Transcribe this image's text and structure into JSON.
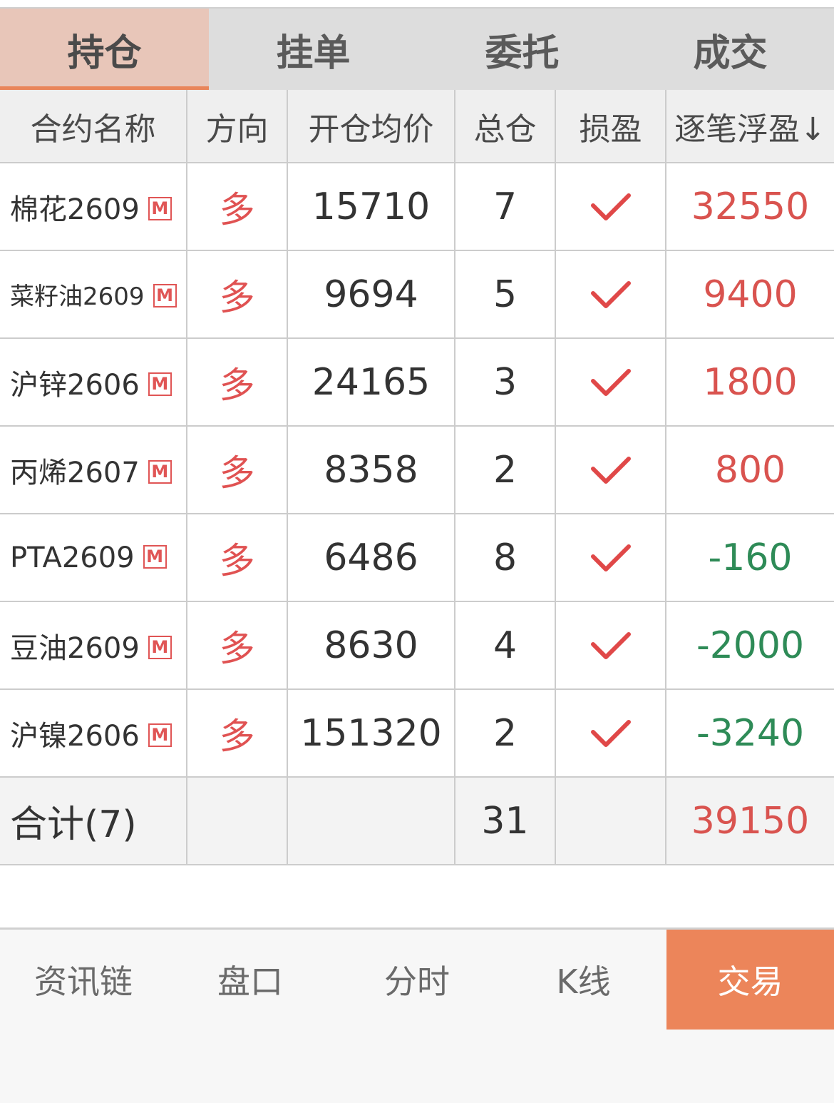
{
  "tabs": [
    "持仓",
    "挂单",
    "委托",
    "成交"
  ],
  "table": {
    "headers": [
      "合约名称",
      "方向",
      "开仓均价",
      "总仓",
      "损盈",
      "逐笔浮盈↓"
    ],
    "rows": [
      {
        "name": "棉花2609",
        "badge": "M",
        "direction": "多",
        "avg_price": "15710",
        "total": "7",
        "profit": "32550"
      },
      {
        "name": "菜籽油2609",
        "badge": "M",
        "direction": "多",
        "avg_price": "9694",
        "total": "5",
        "profit": "9400"
      },
      {
        "name": "沪锌2606",
        "badge": "M",
        "direction": "多",
        "avg_price": "24165",
        "total": "3",
        "profit": "1800"
      },
      {
        "name": "丙烯2607",
        "badge": "M",
        "direction": "多",
        "avg_price": "8358",
        "total": "2",
        "profit": "800"
      },
      {
        "name": "PTA2609",
        "badge": "M",
        "direction": "多",
        "avg_price": "6486",
        "total": "8",
        "profit": "-160"
      },
      {
        "name": "豆油2609",
        "badge": "M",
        "direction": "多",
        "avg_price": "8630",
        "total": "4",
        "profit": "-2000"
      },
      {
        "name": "沪镍2606",
        "badge": "M",
        "direction": "多",
        "avg_price": "151320",
        "total": "2",
        "profit": "-3240"
      }
    ],
    "summary": {
      "label": "合计(7)",
      "total": "31",
      "profit": "39150"
    }
  },
  "bottom_nav": [
    "资讯链",
    "盘口",
    "分时",
    "K线",
    "交易"
  ],
  "colors": {
    "accent": "#ec855a",
    "positive": "#d9534f",
    "negative": "#2e8b57",
    "active_tab_bg": "#e8c6b9"
  }
}
